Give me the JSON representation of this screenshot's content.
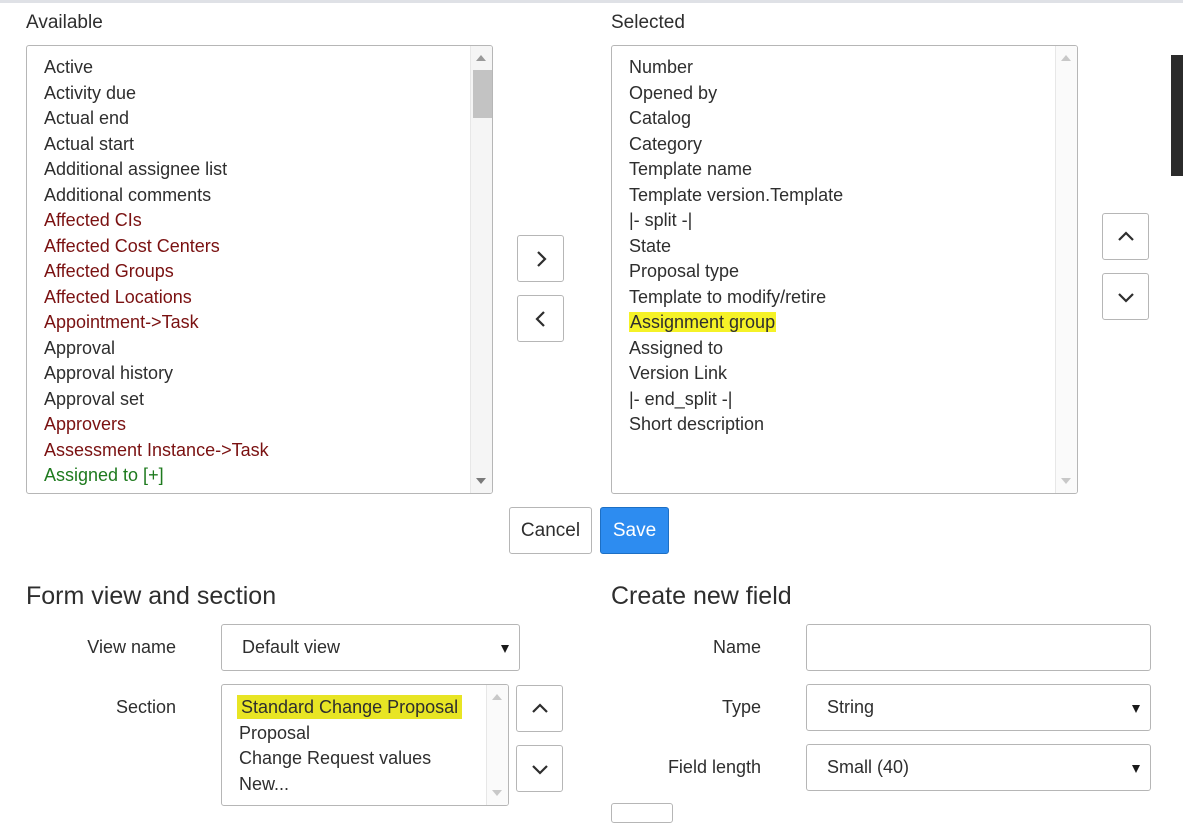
{
  "available": {
    "label": "Available",
    "items": [
      {
        "text": "Active",
        "color": "#2e2e2e"
      },
      {
        "text": "Activity due",
        "color": "#2e2e2e"
      },
      {
        "text": "Actual end",
        "color": "#2e2e2e"
      },
      {
        "text": "Actual start",
        "color": "#2e2e2e"
      },
      {
        "text": "Additional assignee list",
        "color": "#2e2e2e"
      },
      {
        "text": "Additional comments",
        "color": "#2e2e2e"
      },
      {
        "text": "Affected CIs",
        "color": "#7a1111"
      },
      {
        "text": "Affected Cost Centers",
        "color": "#7a1111"
      },
      {
        "text": "Affected Groups",
        "color": "#7a1111"
      },
      {
        "text": "Affected Locations",
        "color": "#7a1111"
      },
      {
        "text": "Appointment->Task",
        "color": "#7a1111"
      },
      {
        "text": "Approval",
        "color": "#2e2e2e"
      },
      {
        "text": "Approval history",
        "color": "#2e2e2e"
      },
      {
        "text": "Approval set",
        "color": "#2e2e2e"
      },
      {
        "text": "Approvers",
        "color": "#7a1111"
      },
      {
        "text": "Assessment Instance->Task",
        "color": "#7a1111"
      },
      {
        "text": "Assigned to [+]",
        "color": "#1e7a1e"
      }
    ]
  },
  "selected": {
    "label": "Selected",
    "items": [
      {
        "text": "Number"
      },
      {
        "text": "Opened by"
      },
      {
        "text": "Catalog"
      },
      {
        "text": "Category"
      },
      {
        "text": "Template name"
      },
      {
        "text": "Template version.Template"
      },
      {
        "text": "|- split -|"
      },
      {
        "text": "State"
      },
      {
        "text": "Proposal type"
      },
      {
        "text": "Template to modify/retire"
      },
      {
        "text": "Assignment group",
        "highlight": true
      },
      {
        "text": "Assigned to"
      },
      {
        "text": "Version Link"
      },
      {
        "text": "|- end_split -|"
      },
      {
        "text": "Short description"
      }
    ]
  },
  "transfer": {
    "add_icon": "chevron-right-icon",
    "remove_icon": "chevron-left-icon"
  },
  "order": {
    "up_icon": "chevron-up-icon",
    "down_icon": "chevron-down-icon"
  },
  "actions": {
    "cancel_label": "Cancel",
    "save_label": "Save",
    "save_color": "#2d8cf0"
  },
  "form_view": {
    "title": "Form view and section",
    "view_name_label": "View name",
    "view_name_value": "Default view",
    "section_label": "Section",
    "sections": [
      {
        "text": "Standard Change Proposal",
        "highlight": true
      },
      {
        "text": "Proposal"
      },
      {
        "text": "Change Request values"
      },
      {
        "text": "New..."
      }
    ]
  },
  "new_field": {
    "title": "Create new field",
    "name_label": "Name",
    "name_value": "",
    "type_label": "Type",
    "type_value": "String",
    "length_label": "Field length",
    "length_value": "Small (40)"
  },
  "colors": {
    "highlight": "#f5f227",
    "reference_field": "#7a1111",
    "expandable_field": "#1e7a1e"
  }
}
